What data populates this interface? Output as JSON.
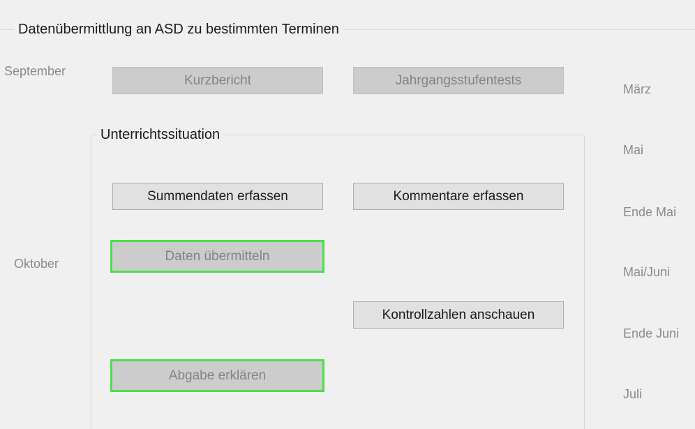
{
  "outer_group": {
    "title": "Datenübermittlung an ASD zu bestimmten Terminen"
  },
  "inner_group": {
    "title": "Unterrichtssituation"
  },
  "left_periods": {
    "september": "September",
    "oktober": "Oktober"
  },
  "right_periods": {
    "maerz": "März",
    "mai": "Mai",
    "ende_mai": "Ende Mai",
    "mai_juni": "Mai/Juni",
    "ende_juni": "Ende Juni",
    "juli": "Juli"
  },
  "buttons": {
    "kurzbericht": "Kurzbericht",
    "jahrgangsstufentests": "Jahrgangsstufentests",
    "summendaten": "Summendaten erfassen",
    "kommentare": "Kommentare erfassen",
    "daten_uebermitteln": "Daten übermitteln",
    "kontrollzahlen": "Kontrollzahlen anschauen",
    "abgabe": "Abgabe erklären"
  },
  "colors": {
    "highlight_border": "#4cde4c",
    "disabled_text": "#838383"
  }
}
